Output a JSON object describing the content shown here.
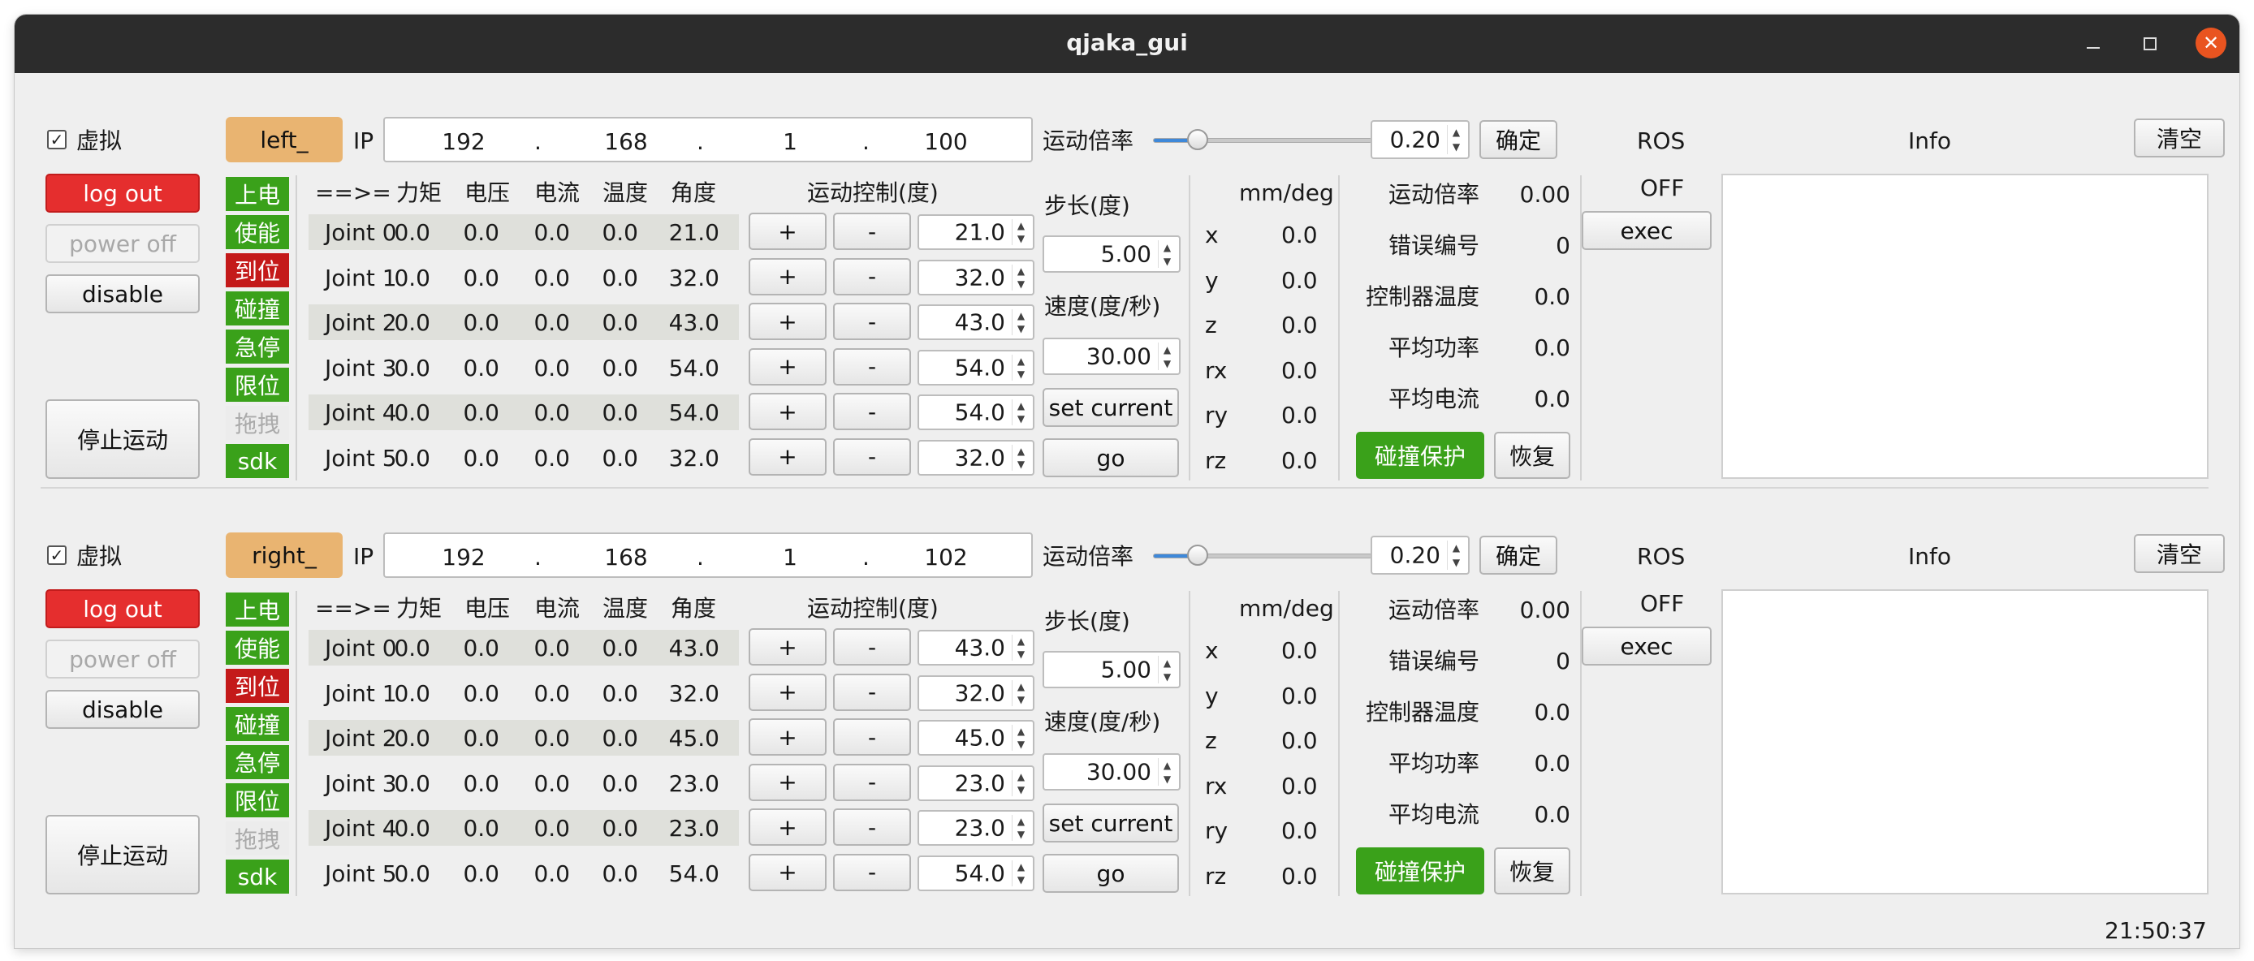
{
  "window": {
    "title": "qjaka_gui",
    "clock": "21:50:37"
  },
  "headers": {
    "arrow": "==>=",
    "torque": "力矩",
    "voltage": "电压",
    "current": "电流",
    "temp": "温度",
    "angle": "角度",
    "motion_ctrl": "运动控制(度)",
    "step": "步长(度)",
    "speed": "速度(度/秒)",
    "unit": "mm/deg",
    "ratio": "运动倍率",
    "ip_label": "IP",
    "ros": "ROS",
    "info": "Info",
    "clear": "清空",
    "confirm": "确定"
  },
  "buttons": {
    "logout": "log out",
    "poweroff": "power off",
    "disable": "disable",
    "stop": "停止运动",
    "set_current": "set current",
    "go": "go",
    "exec": "exec",
    "collision": "碰撞保护",
    "recover": "恢复",
    "plus": "+",
    "minus": "-"
  },
  "stats_labels": [
    "运动倍率",
    "错误编号",
    "控制器温度",
    "平均功率",
    "平均电流"
  ],
  "status_labels": [
    "上电",
    "使能",
    "到位",
    "碰撞",
    "急停",
    "限位",
    "拖拽",
    "sdk"
  ],
  "status_colors": [
    "green",
    "green",
    "red",
    "green",
    "green",
    "green",
    "gray",
    "green"
  ],
  "pose_labels": [
    "x",
    "y",
    "z",
    "rx",
    "ry",
    "rz"
  ],
  "panels": [
    {
      "virtual_label": "虚拟",
      "virtual_checked": true,
      "name": "left_",
      "ip": [
        "192",
        "168",
        "1",
        "100"
      ],
      "ip_dots": [
        ".",
        ".",
        "."
      ],
      "speed_ratio": "0.20",
      "ratio_slider": 0.2,
      "step": "5.00",
      "speed": "30.00",
      "ros_state": "OFF",
      "joints": [
        {
          "name": "Joint 0",
          "torque": "0.0",
          "voltage": "0.0",
          "current": "0.0",
          "temp": "0.0",
          "angle": "21.0",
          "target": "21.0"
        },
        {
          "name": "Joint 1",
          "torque": "0.0",
          "voltage": "0.0",
          "current": "0.0",
          "temp": "0.0",
          "angle": "32.0",
          "target": "32.0"
        },
        {
          "name": "Joint 2",
          "torque": "0.0",
          "voltage": "0.0",
          "current": "0.0",
          "temp": "0.0",
          "angle": "43.0",
          "target": "43.0"
        },
        {
          "name": "Joint 3",
          "torque": "0.0",
          "voltage": "0.0",
          "current": "0.0",
          "temp": "0.0",
          "angle": "54.0",
          "target": "54.0"
        },
        {
          "name": "Joint 4",
          "torque": "0.0",
          "voltage": "0.0",
          "current": "0.0",
          "temp": "0.0",
          "angle": "54.0",
          "target": "54.0"
        },
        {
          "name": "Joint 5",
          "torque": "0.0",
          "voltage": "0.0",
          "current": "0.0",
          "temp": "0.0",
          "angle": "32.0",
          "target": "32.0"
        }
      ],
      "pose": [
        "0.0",
        "0.0",
        "0.0",
        "0.0",
        "0.0",
        "0.0"
      ],
      "stats": [
        "0.00",
        "0",
        "0.0",
        "0.0",
        "0.0"
      ]
    },
    {
      "virtual_label": "虚拟",
      "virtual_checked": true,
      "name": "right_",
      "ip": [
        "192",
        "168",
        "1",
        "102"
      ],
      "ip_dots": [
        ".",
        ".",
        "."
      ],
      "speed_ratio": "0.20",
      "ratio_slider": 0.2,
      "step": "5.00",
      "speed": "30.00",
      "ros_state": "OFF",
      "joints": [
        {
          "name": "Joint 0",
          "torque": "0.0",
          "voltage": "0.0",
          "current": "0.0",
          "temp": "0.0",
          "angle": "43.0",
          "target": "43.0"
        },
        {
          "name": "Joint 1",
          "torque": "0.0",
          "voltage": "0.0",
          "current": "0.0",
          "temp": "0.0",
          "angle": "32.0",
          "target": "32.0"
        },
        {
          "name": "Joint 2",
          "torque": "0.0",
          "voltage": "0.0",
          "current": "0.0",
          "temp": "0.0",
          "angle": "45.0",
          "target": "45.0"
        },
        {
          "name": "Joint 3",
          "torque": "0.0",
          "voltage": "0.0",
          "current": "0.0",
          "temp": "0.0",
          "angle": "23.0",
          "target": "23.0"
        },
        {
          "name": "Joint 4",
          "torque": "0.0",
          "voltage": "0.0",
          "current": "0.0",
          "temp": "0.0",
          "angle": "23.0",
          "target": "23.0"
        },
        {
          "name": "Joint 5",
          "torque": "0.0",
          "voltage": "0.0",
          "current": "0.0",
          "temp": "0.0",
          "angle": "54.0",
          "target": "54.0"
        }
      ],
      "pose": [
        "0.0",
        "0.0",
        "0.0",
        "0.0",
        "0.0",
        "0.0"
      ],
      "stats": [
        "0.00",
        "0",
        "0.0",
        "0.0",
        "0.0"
      ]
    }
  ]
}
